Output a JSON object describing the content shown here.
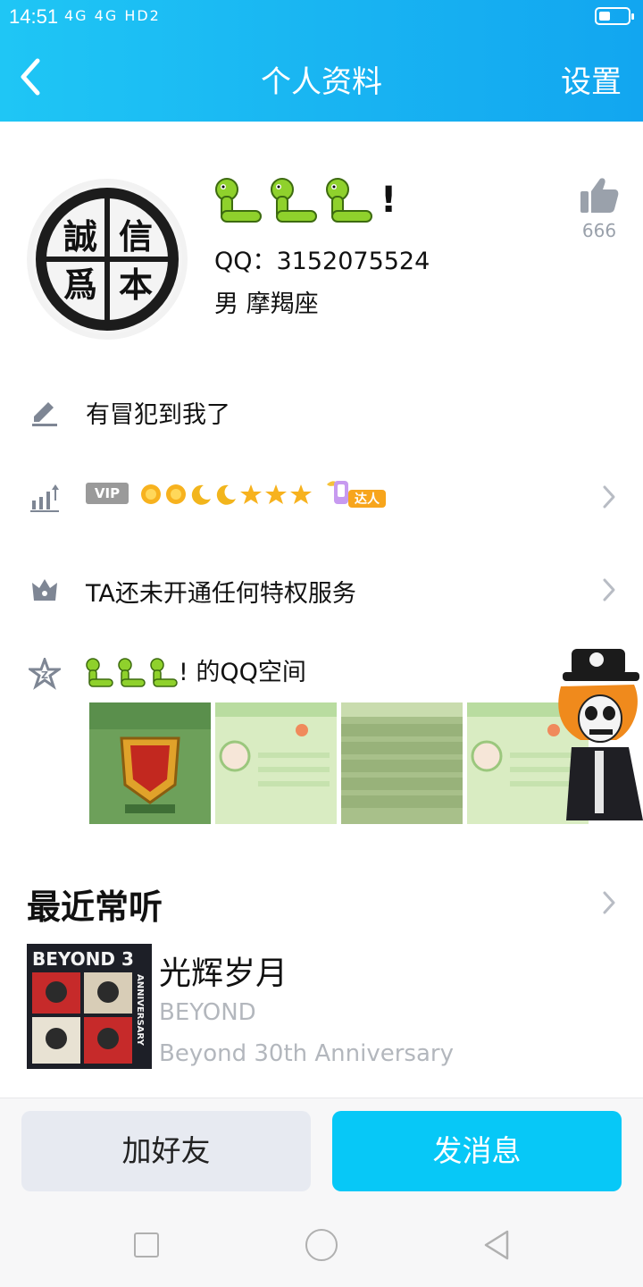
{
  "status_bar": {
    "time": "14:51",
    "indicators": "4G 4G HD2"
  },
  "header": {
    "back_icon": "chevron-left-icon",
    "title": "个人资料",
    "settings_label": "设置"
  },
  "profile": {
    "avatar_chars": [
      "誠",
      "信",
      "爲",
      "本"
    ],
    "nickname_suffix": "!",
    "qq": "QQ：3152075524",
    "gender_zodiac": "男  摩羯座",
    "like_count": "666"
  },
  "rows": {
    "signature": "有冒犯到我了",
    "vip_label": "VIP",
    "daren_label": "达人",
    "privilege": "TA还未开通任何特权服务",
    "qzone": "的QQ空间"
  },
  "recent": {
    "title": "最近常听",
    "song": "光辉岁月",
    "artist": "BEYOND",
    "album": "Beyond 30th Anniversary",
    "cover_text": "BEYOND 3",
    "cover_side": "ANNIVERSARY"
  },
  "actions": {
    "add_friend": "加好友",
    "send_message": "发消息"
  },
  "colors": {
    "header": "#19b5f2",
    "primary_button": "#07c8f7",
    "secondary_button": "#e7eaf1"
  }
}
